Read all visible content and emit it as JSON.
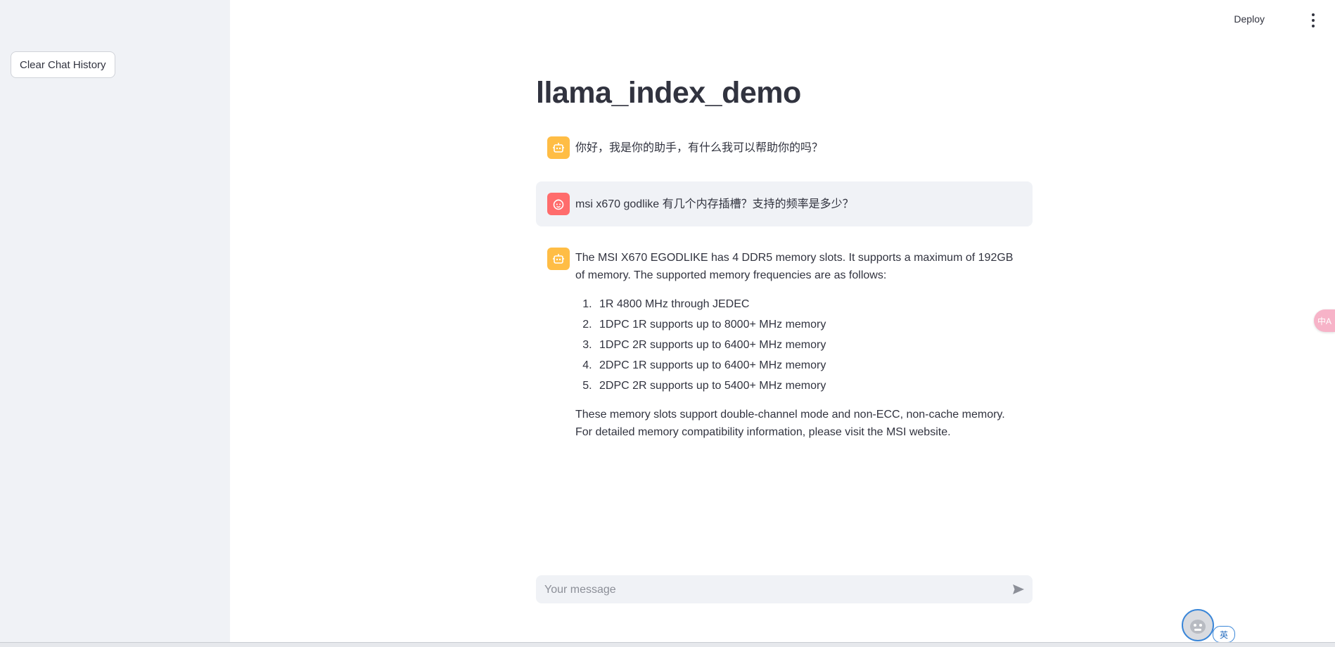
{
  "sidebar": {
    "clear_button_label": "Clear Chat History"
  },
  "topbar": {
    "deploy_label": "Deploy",
    "menu_icon": "more-vertical-icon"
  },
  "main": {
    "title": "llama_index_demo",
    "messages": [
      {
        "role": "assistant",
        "avatar_icon": "bot-icon",
        "text": "你好，我是你的助手，有什么我可以帮助你的吗？"
      },
      {
        "role": "user",
        "avatar_icon": "user-face-icon",
        "text": "msi x670 godlike 有几个内存插槽？支持的频率是多少？"
      },
      {
        "role": "assistant",
        "avatar_icon": "bot-icon",
        "intro": "The MSI X670 EGODLIKE has 4 DDR5 memory slots. It supports a maximum of 192GB of memory. The supported memory frequencies are as follows:",
        "list": [
          "1R 4800 MHz through JEDEC",
          "1DPC 1R supports up to 8000+ MHz memory",
          "1DPC 2R supports up to 6400+ MHz memory",
          "2DPC 1R supports up to 6400+ MHz memory",
          "2DPC 2R supports up to 5400+ MHz memory"
        ],
        "outro": "These memory slots support double-channel mode and non-ECC, non-cache memory. For detailed memory compatibility information, please visit the MSI website."
      }
    ]
  },
  "chat_input": {
    "placeholder": "Your message",
    "send_icon": "send-icon"
  },
  "floating_tab": {
    "label": "中A"
  },
  "ime": {
    "badge": "英"
  },
  "colors": {
    "sidebar_bg": "#f0f2f6",
    "bot_avatar": "#ffbd45",
    "user_avatar": "#ff6c6c",
    "text": "#31333f"
  }
}
